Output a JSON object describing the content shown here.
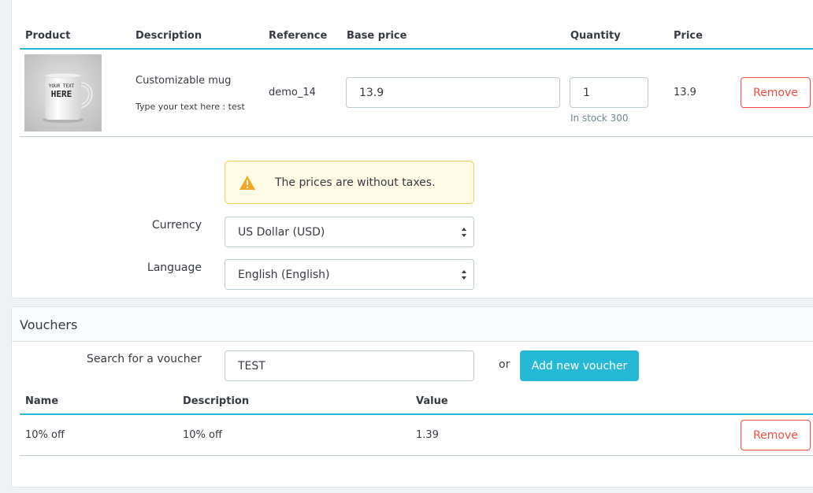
{
  "cart": {
    "columns": [
      "Product",
      "Description",
      "Reference",
      "Base price",
      "Quantity",
      "Price"
    ],
    "product": {
      "mug_text_line1": "YOUR TEXT",
      "mug_text_line2": "HERE",
      "name": "Customizable mug",
      "customization": "Type your text here : test",
      "reference": "demo_14",
      "base_price": "13.9",
      "quantity": "1",
      "stock": "In stock 300",
      "price": "13.9",
      "remove_label": "Remove"
    },
    "alert_text": "The prices are without taxes.",
    "currency_label": "Currency",
    "currency_value": "US Dollar (USD)",
    "language_label": "Language",
    "language_value": "English (English)"
  },
  "vouchers": {
    "title": "Vouchers",
    "search_label": "Search for a voucher",
    "search_value": "TEST",
    "or_text": "or",
    "add_button": "Add new voucher",
    "columns": [
      "Name",
      "Description",
      "Value"
    ],
    "rows": [
      {
        "name": "10% off",
        "description": "10% off",
        "value": "1.39",
        "remove_label": "Remove"
      }
    ]
  },
  "colors": {
    "accent": "#25b9d7",
    "danger": "#f54c3e",
    "warning": "#f5cf51"
  }
}
